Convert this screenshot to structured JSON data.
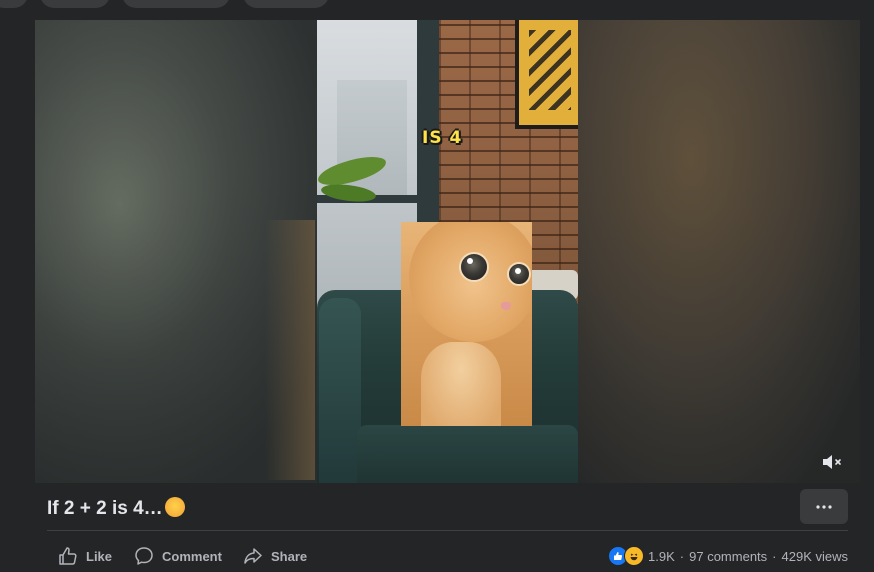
{
  "video": {
    "overlay_text": "IS 4",
    "mute_icon": "speaker-muted-icon"
  },
  "post": {
    "title": "If 2 + 2 is 4…",
    "title_emoji": "exploding-head-emoji",
    "more_icon": "more-dots-icon"
  },
  "actions": {
    "like_label": "Like",
    "comment_label": "Comment",
    "share_label": "Share"
  },
  "stats": {
    "reactions_count": "1.9K",
    "comments": "97 comments",
    "views": "429K views",
    "separator": "·",
    "reaction_icons": [
      "like-reaction-icon",
      "haha-reaction-icon"
    ]
  },
  "colors": {
    "background": "#242526",
    "text_primary": "#e4e6eb",
    "text_secondary": "#b0b3b8",
    "like_blue": "#1877f2",
    "haha_yellow": "#f7b928",
    "overlay_yellow": "#ffe14a"
  }
}
